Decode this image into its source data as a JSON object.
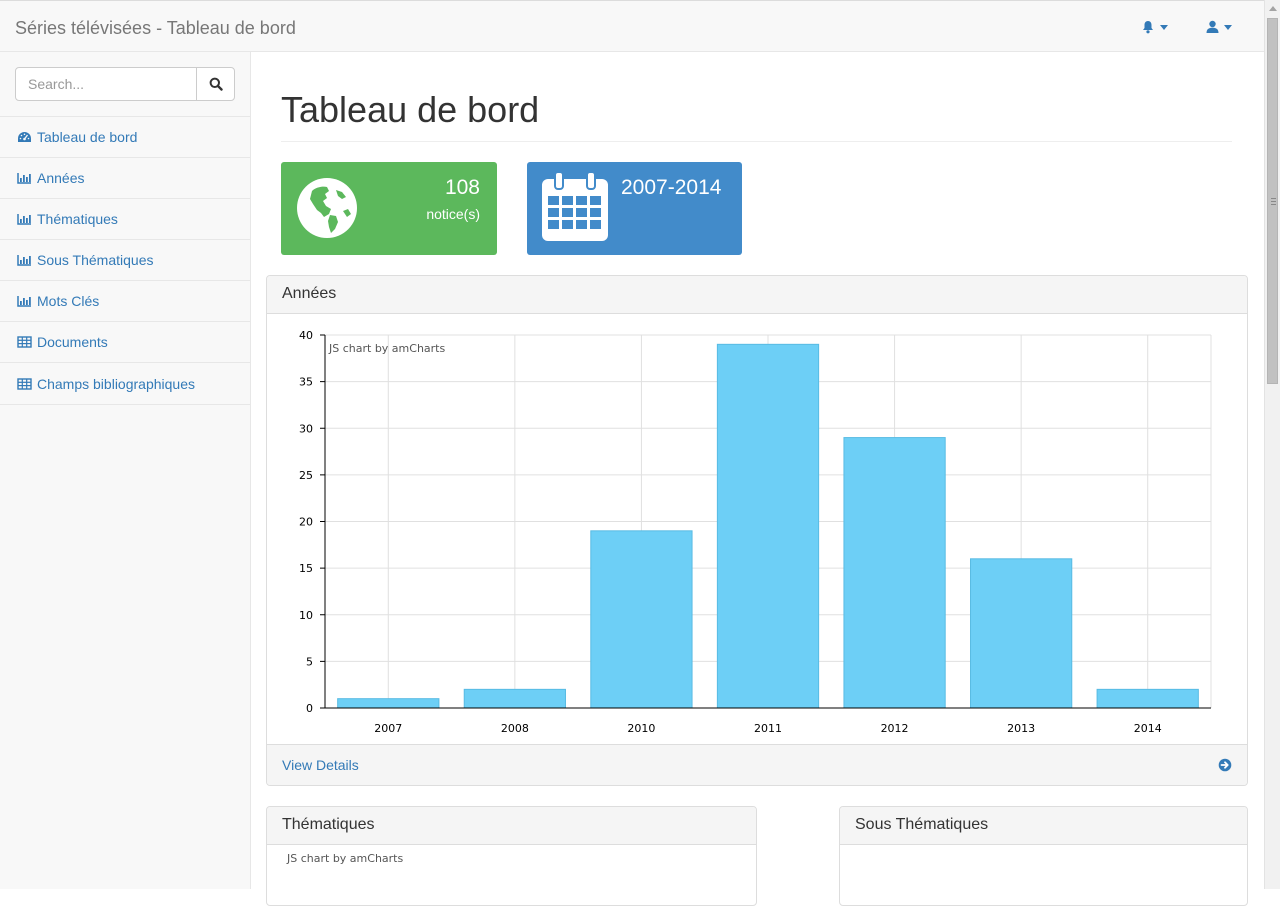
{
  "navbar": {
    "brand": "Séries télévisées - Tableau de bord",
    "notifications_icon": "bell-icon",
    "user_icon": "user-icon"
  },
  "sidebar": {
    "search_placeholder": "Search...",
    "items": [
      {
        "label": "Tableau de bord",
        "icon": "dashboard-icon"
      },
      {
        "label": "Années",
        "icon": "bar-chart-icon"
      },
      {
        "label": "Thématiques",
        "icon": "bar-chart-icon"
      },
      {
        "label": "Sous Thématiques",
        "icon": "bar-chart-icon"
      },
      {
        "label": "Mots Clés",
        "icon": "bar-chart-icon"
      },
      {
        "label": "Documents",
        "icon": "table-icon"
      },
      {
        "label": "Champs bibliographiques",
        "icon": "table-icon"
      }
    ]
  },
  "main": {
    "page_title": "Tableau de bord",
    "stats": [
      {
        "value": "108",
        "label": "notice(s)",
        "icon": "globe-icon",
        "color": "#5cb85c"
      },
      {
        "value": "2007-2014",
        "icon": "calendar-icon",
        "color": "#428bca"
      }
    ],
    "panels": {
      "annees": {
        "title": "Années",
        "footer": "View Details",
        "credit": "JS chart by amCharts"
      },
      "thematiques": {
        "title": "Thématiques",
        "credit": "JS chart by amCharts"
      },
      "sous_thematiques": {
        "title": "Sous Thématiques"
      }
    }
  },
  "colors": {
    "accent": "#337ab7",
    "bar": "#6dcff6",
    "green": "#5cb85c",
    "blue": "#428bca"
  },
  "chart_data": {
    "type": "bar",
    "categories": [
      "2007",
      "2008",
      "2010",
      "2011",
      "2012",
      "2013",
      "2014"
    ],
    "values": [
      1,
      2,
      19,
      39,
      29,
      16,
      2
    ],
    "yticks": [
      "0",
      "5",
      "10",
      "15",
      "20",
      "25",
      "30",
      "35",
      "40"
    ],
    "ylim": [
      0,
      40
    ],
    "grid": true
  }
}
